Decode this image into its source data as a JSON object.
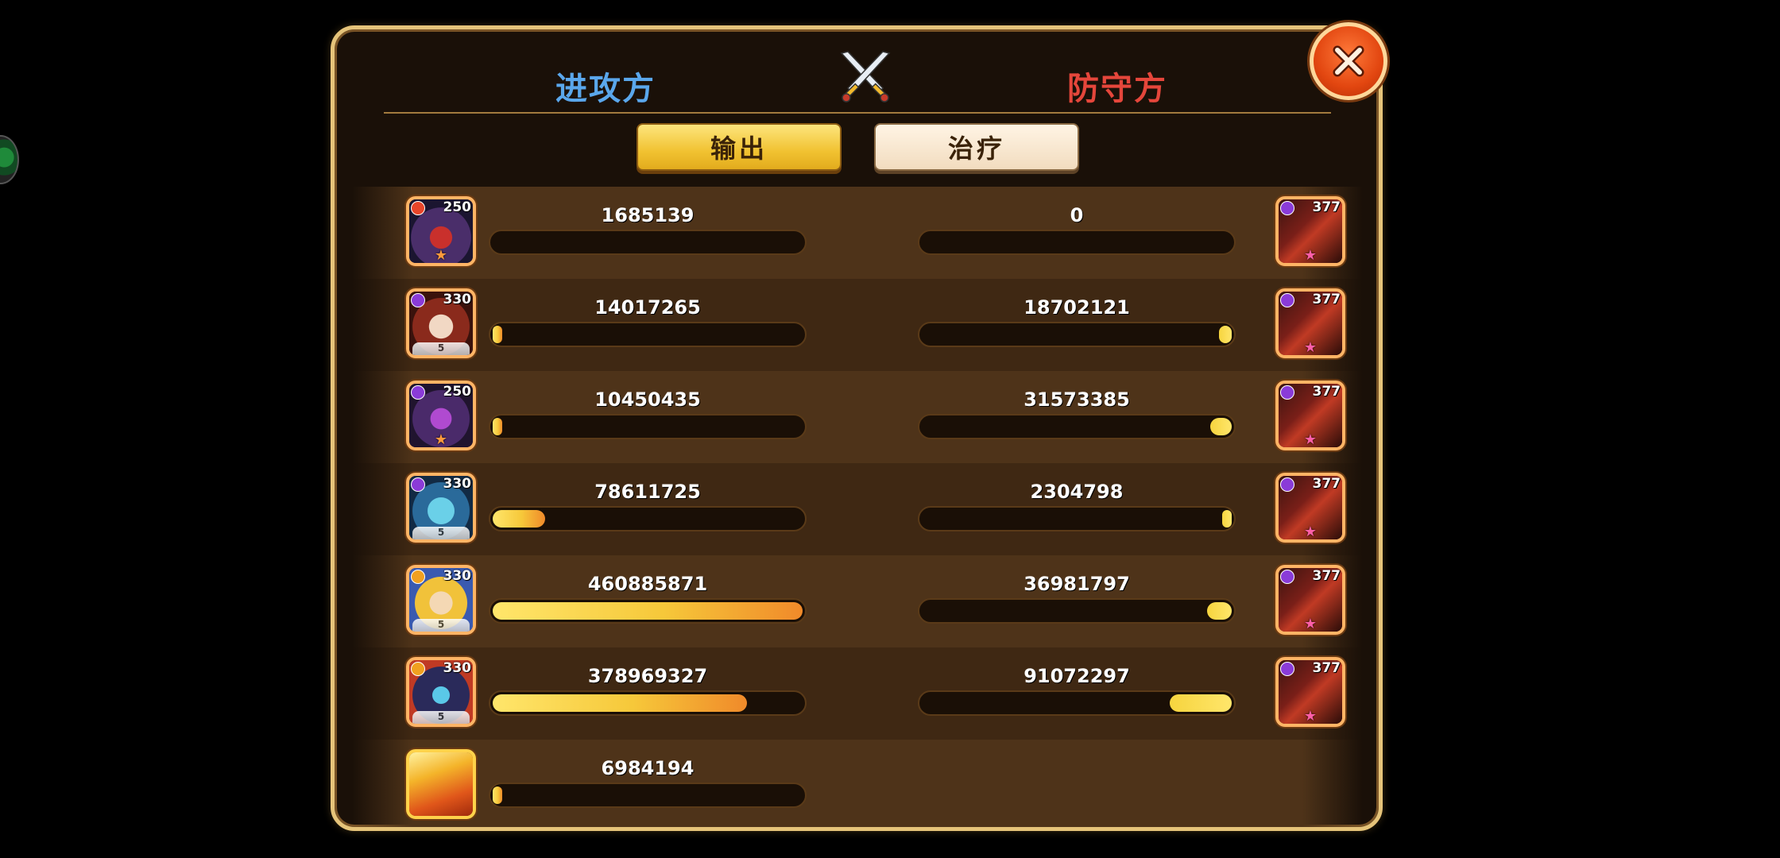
{
  "header": {
    "attacker_label": "进攻方",
    "defender_label": "防守方"
  },
  "tabs": [
    {
      "label": "输出",
      "active": true
    },
    {
      "label": "治疗",
      "active": false
    }
  ],
  "attackers": [
    {
      "value": "1685139",
      "level": "250",
      "share": 0.0
    },
    {
      "value": "14017265",
      "level": "330",
      "share": 0.03
    },
    {
      "value": "10450435",
      "level": "250",
      "share": 0.02
    },
    {
      "value": "78611725",
      "level": "330",
      "share": 0.17
    },
    {
      "value": "460885871",
      "level": "330",
      "share": 1.0
    },
    {
      "value": "378969327",
      "level": "330",
      "share": 0.82
    },
    {
      "value": "6984194",
      "level": "",
      "share": 0.015
    }
  ],
  "defenders": [
    {
      "value": "0",
      "level": "377",
      "share": 0.0
    },
    {
      "value": "18702121",
      "level": "377",
      "share": 0.04
    },
    {
      "value": "31573385",
      "level": "377",
      "share": 0.07
    },
    {
      "value": "2304798",
      "level": "377",
      "share": 0.005
    },
    {
      "value": "36981797",
      "level": "377",
      "share": 0.08
    },
    {
      "value": "91072297",
      "level": "377",
      "share": 0.2
    }
  ],
  "colors": {
    "attacker": "#5aa7ec",
    "defender": "#e5463b",
    "gold": "#f1c231"
  },
  "icons": {
    "crossed_swords": "crossed-swords-icon",
    "close": "close-icon"
  }
}
